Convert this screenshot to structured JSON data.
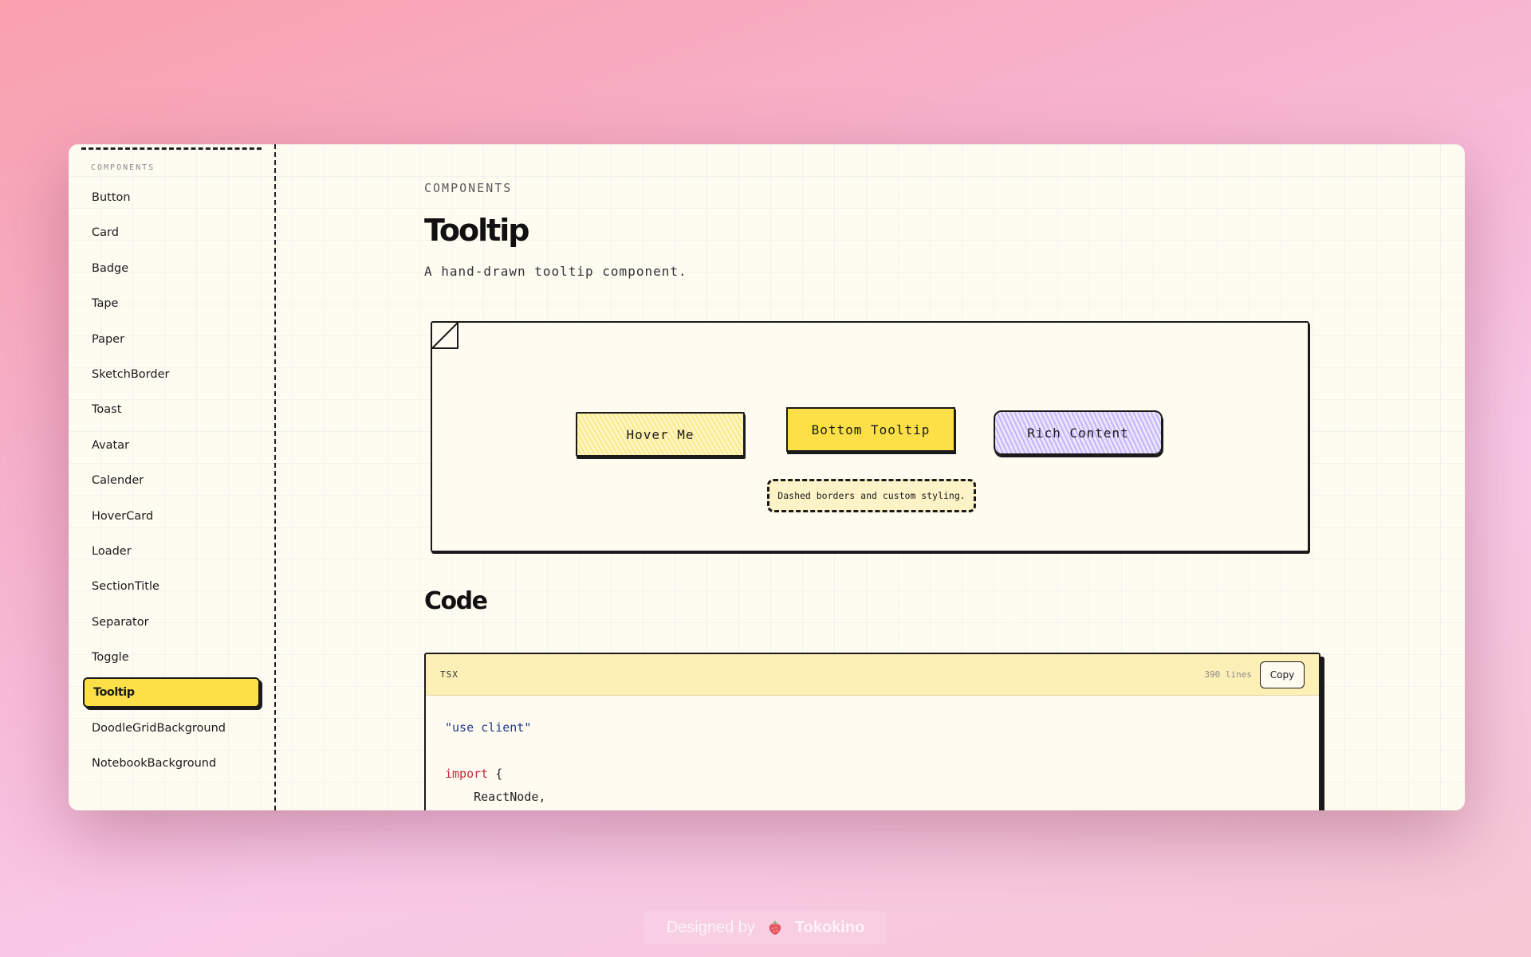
{
  "sidebar": {
    "heading": "COMPONENTS",
    "items": [
      {
        "label": "Button"
      },
      {
        "label": "Card"
      },
      {
        "label": "Badge"
      },
      {
        "label": "Tape"
      },
      {
        "label": "Paper"
      },
      {
        "label": "SketchBorder"
      },
      {
        "label": "Toast"
      },
      {
        "label": "Avatar"
      },
      {
        "label": "Calender"
      },
      {
        "label": "HoverCard"
      },
      {
        "label": "Loader"
      },
      {
        "label": "SectionTitle"
      },
      {
        "label": "Separator"
      },
      {
        "label": "Toggle"
      },
      {
        "label": "Tooltip",
        "active": true
      },
      {
        "label": "DoodleGridBackground"
      },
      {
        "label": "NotebookBackground"
      }
    ]
  },
  "main": {
    "eyebrow": "COMPONENTS",
    "title": "Tooltip",
    "description": "A hand-drawn tooltip component.",
    "demo": {
      "buttons": {
        "hover": "Hover Me",
        "bottom": "Bottom Tooltip",
        "rich": "Rich Content"
      },
      "tooltip_text": "Dashed borders and custom styling."
    },
    "code_section_title": "Code",
    "code": {
      "language": "TSX",
      "lines_label": "390 lines",
      "copy_label": "Copy",
      "tokens": {
        "line1": "\"use client\"",
        "kw_import": "import",
        "brace": " {",
        "line4": "    ReactNode,"
      }
    }
  },
  "footer": {
    "designed_by": "Designed by",
    "brand": "Tokokino"
  },
  "colors": {
    "accent_yellow": "#fde047",
    "accent_purple": "#c4b5fd",
    "paper": "#fefbf1",
    "ink": "#1a1a1a"
  },
  "icons": {
    "brand": "strawberry-icon"
  }
}
